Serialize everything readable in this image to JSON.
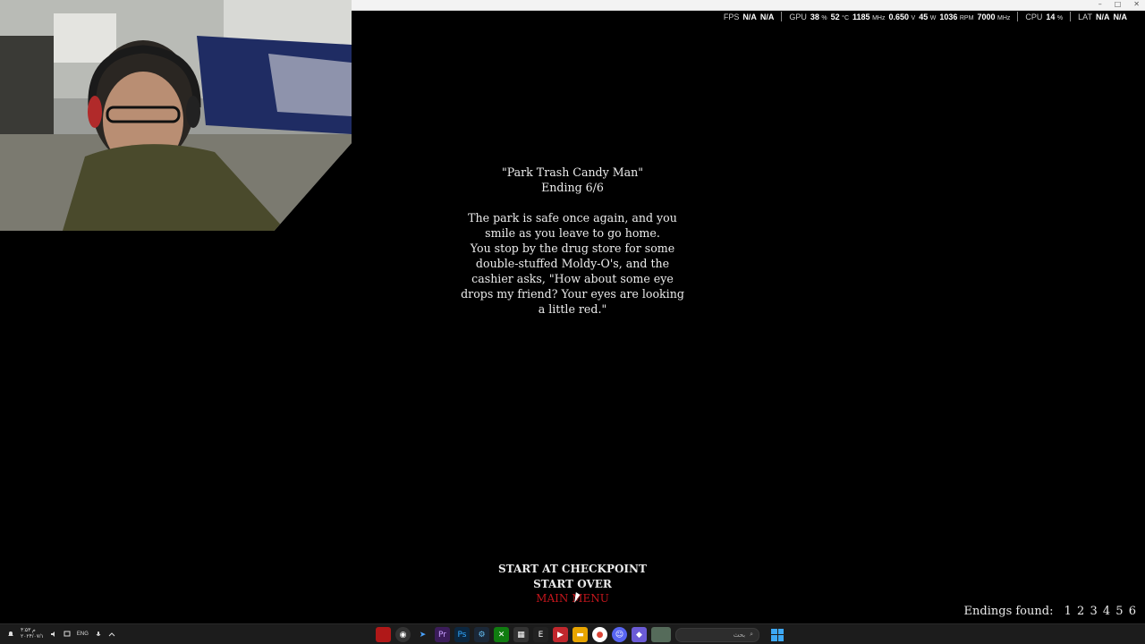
{
  "window": {
    "buttons": [
      "–",
      "□",
      "✕"
    ]
  },
  "overlay_stats": {
    "fps": {
      "label": "FPS",
      "v1": "N/A",
      "v2": "N/A"
    },
    "gpu": {
      "label": "GPU",
      "usage": "38",
      "usage_unit": "%",
      "temp": "52",
      "temp_unit": "°C",
      "clock": "1185",
      "clock_unit": "MHz",
      "voltage": "0.650",
      "voltage_unit": "V",
      "power": "45",
      "power_unit": "W",
      "fan": "1036",
      "fan_unit": "RPM",
      "mem": "7000",
      "mem_unit": "MHz"
    },
    "cpu": {
      "label": "CPU",
      "usage": "14",
      "usage_unit": "%"
    },
    "lat": {
      "label": "LAT",
      "v1": "N/A",
      "v2": "N/A"
    }
  },
  "ending": {
    "title": "\"Park Trash Candy Man\"",
    "subtitle": "Ending 6/6",
    "lines": [
      "The park is safe once again, and you",
      "smile as you leave to go home.",
      "You stop by the drug store for some",
      "double-stuffed Moldy-O's, and the",
      "cashier asks, \"How about some eye",
      "drops my friend? Your eyes are looking",
      "a little red.\""
    ]
  },
  "menu": {
    "items": [
      "START AT CHECKPOINT",
      "START OVER",
      "MAIN MENU"
    ],
    "selected": "MAIN MENU"
  },
  "endings_found": {
    "label": "Endings found:",
    "numbers": [
      "1",
      "2",
      "3",
      "4",
      "5",
      "6"
    ]
  },
  "taskbar": {
    "time": "م ۴:۵۳",
    "date": "۲۰۲۴/۰۷/۱",
    "language": "ENG",
    "search_placeholder": "بحث",
    "colors": {
      "background": "#1c1c1c",
      "accent": "#3da8f5"
    }
  },
  "colors": {
    "text": "#ececec",
    "selected_menu": "#c4161c",
    "background": "#000000"
  }
}
